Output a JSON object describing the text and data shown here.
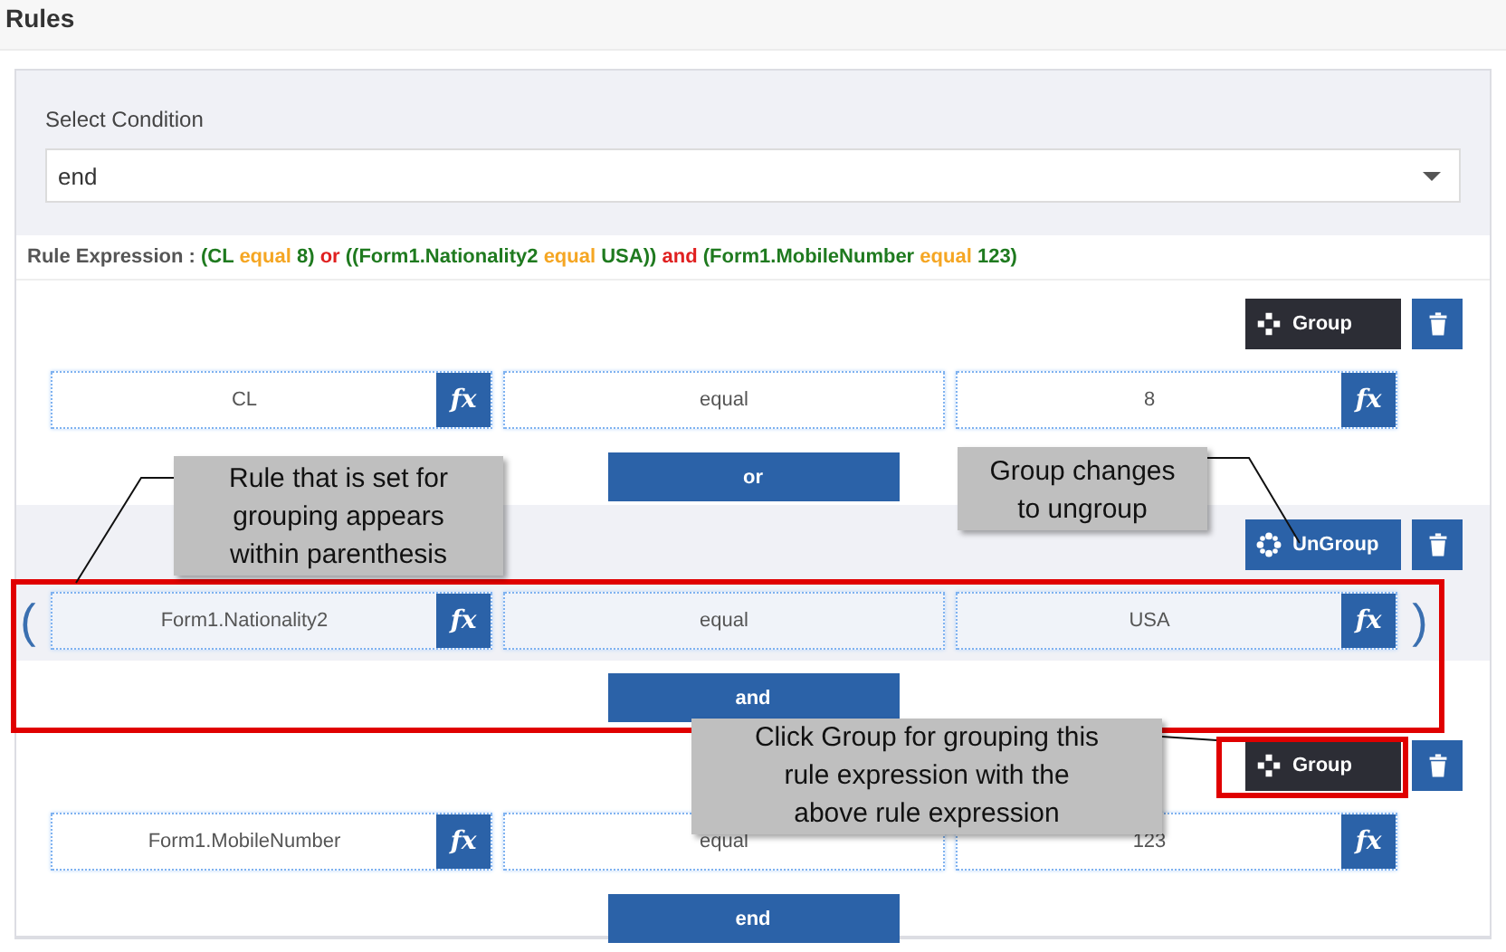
{
  "page_title": "Rules",
  "condition": {
    "label": "Select Condition",
    "value": "end"
  },
  "rule_expression": {
    "label": "Rule Expression :",
    "tokens": [
      {
        "text": "(CL",
        "kind": "operand"
      },
      {
        "text": "equal",
        "kind": "operator"
      },
      {
        "text": "8)",
        "kind": "operand"
      },
      {
        "text": "or",
        "kind": "connector"
      },
      {
        "text": "((Form1.Nationality2",
        "kind": "operand"
      },
      {
        "text": "equal",
        "kind": "operator"
      },
      {
        "text": "USA))",
        "kind": "operand"
      },
      {
        "text": "and",
        "kind": "connector"
      },
      {
        "text": "(Form1.MobileNumber",
        "kind": "operand"
      },
      {
        "text": "equal",
        "kind": "operator"
      },
      {
        "text": "123)",
        "kind": "operand"
      }
    ]
  },
  "rules": [
    {
      "group_button": {
        "label": "Group",
        "kind": "group"
      },
      "grouped": false,
      "field": "CL",
      "field_fx": "fx",
      "operator": "equal",
      "value": "8",
      "value_fx": "fx",
      "connector": "or"
    },
    {
      "group_button": {
        "label": "UnGroup",
        "kind": "ungroup"
      },
      "grouped": true,
      "open_paren": "(",
      "close_paren": ")",
      "field": "Form1.Nationality2",
      "field_fx": "fx",
      "operator": "equal",
      "value": "USA",
      "value_fx": "fx",
      "connector": "and"
    },
    {
      "group_button": {
        "label": "Group",
        "kind": "group"
      },
      "grouped": false,
      "field": "Form1.MobileNumber",
      "field_fx": "fx",
      "operator": "equal",
      "value": "123",
      "value_fx": "fx",
      "connector": "end"
    }
  ],
  "annotations": [
    {
      "lines": [
        "Rule that is set for",
        "grouping appears",
        "within parenthesis"
      ],
      "kind": "left"
    },
    {
      "lines": [
        "Group changes",
        "to ungroup"
      ],
      "kind": "right"
    },
    {
      "lines": [
        "Click Group for grouping this",
        "rule expression with the",
        "above rule expression"
      ],
      "kind": "bottom"
    }
  ]
}
